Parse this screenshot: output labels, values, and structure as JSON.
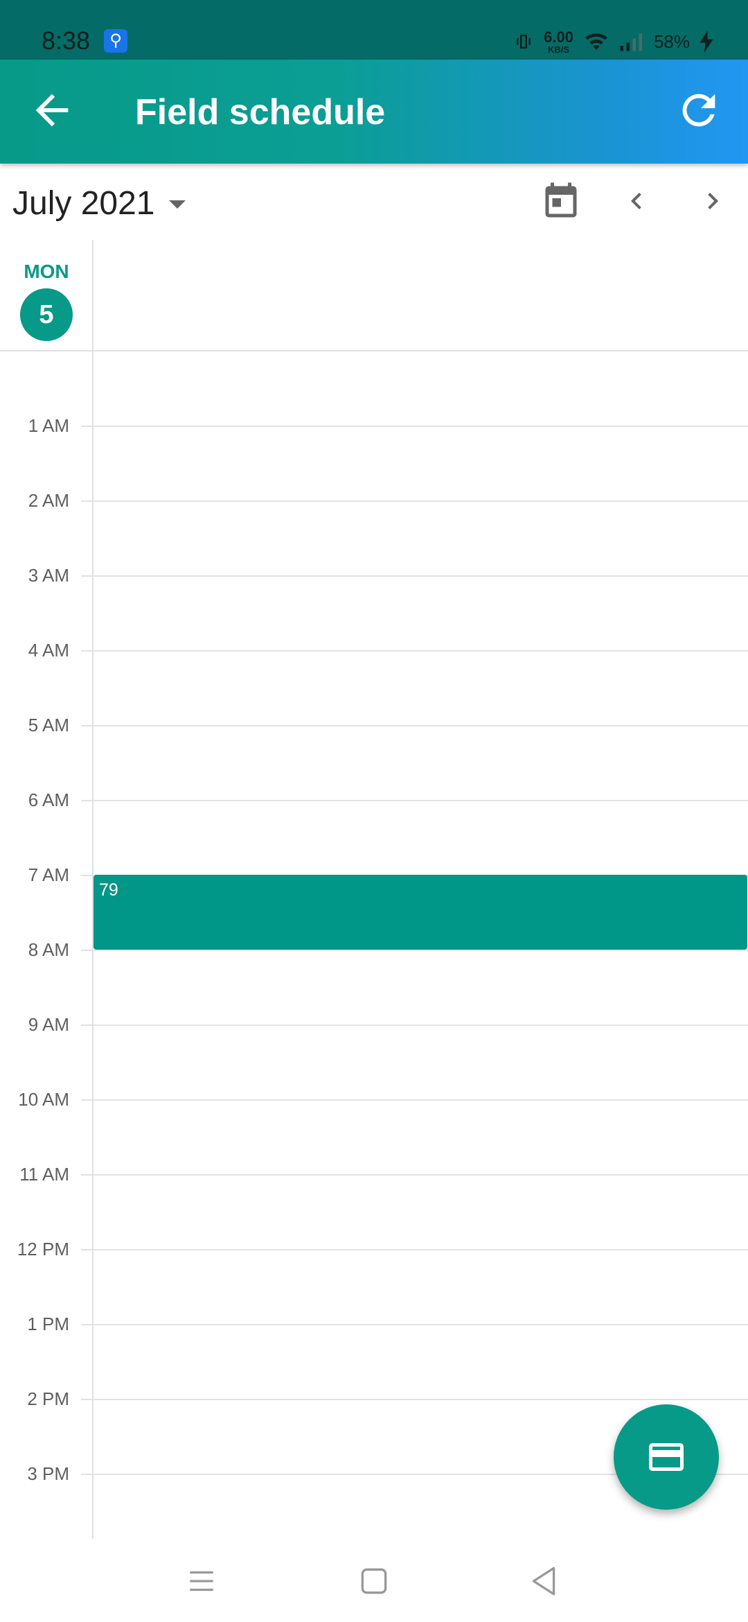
{
  "status_bar": {
    "time": "8:38",
    "net_speed_value": "6.00",
    "net_speed_unit": "KB/S",
    "battery": "58%",
    "icons": [
      "usb-debug-icon",
      "vibrate-icon",
      "wifi-icon",
      "signal-icon",
      "charging-icon"
    ]
  },
  "app_bar": {
    "title": "Field schedule",
    "back_icon": "arrow-back-icon",
    "refresh_icon": "refresh-icon"
  },
  "calendar_header": {
    "month": "July 2021",
    "icons": [
      "dropdown-caret-icon",
      "calendar-today-icon",
      "chevron-left-icon",
      "chevron-right-icon"
    ]
  },
  "day": {
    "weekday": "MON",
    "date": "5"
  },
  "hours": [
    "1 AM",
    "2 AM",
    "3 AM",
    "4 AM",
    "5 AM",
    "6 AM",
    "7 AM",
    "8 AM",
    "9 AM",
    "10 AM",
    "11 AM",
    "12 PM",
    "1 PM",
    "2 PM",
    "3 PM"
  ],
  "events": [
    {
      "title": "79",
      "start": "7 AM",
      "end": "8 AM"
    }
  ],
  "fab": {
    "icon": "card-icon"
  },
  "nav_bar": {
    "icons": [
      "recents-icon",
      "home-icon",
      "back-nav-icon"
    ]
  },
  "colors": {
    "primary": "#079a88",
    "event": "#009688",
    "gradient_end": "#2196f3"
  }
}
